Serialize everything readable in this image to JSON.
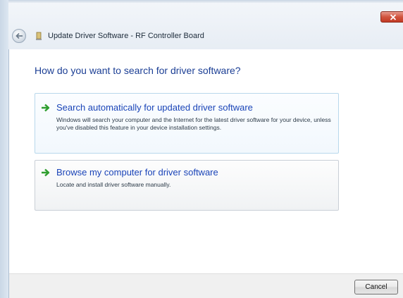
{
  "window": {
    "title": "Update Driver Software - RF Controller Board",
    "back_icon": "back-arrow-icon",
    "close_icon": "close-icon"
  },
  "main": {
    "heading": "How do you want to search for driver software?",
    "options": [
      {
        "title": "Search automatically for updated driver software",
        "description": "Windows will search your computer and the Internet for the latest driver software for your device, unless you've disabled this feature in your device installation settings.",
        "icon": "green-arrow-icon"
      },
      {
        "title": "Browse my computer for driver software",
        "description": "Locate and install driver software manually.",
        "icon": "green-arrow-icon"
      }
    ]
  },
  "footer": {
    "cancel_label": "Cancel"
  },
  "colors": {
    "heading": "#1c3f95",
    "link": "#1a44b8",
    "arrow": "#2f9e2f",
    "close": "#c23b24"
  }
}
